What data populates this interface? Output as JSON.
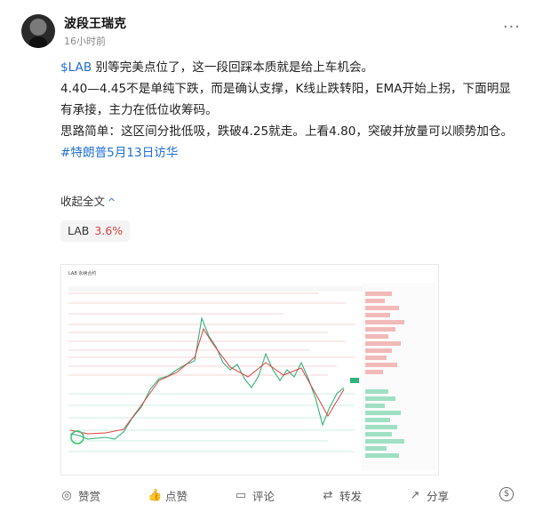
{
  "post": {
    "author": "波段王瑞克",
    "time": "16小时前",
    "more": "···",
    "line1_ticker": "$LAB",
    "line1_rest": " 别等完美点位了，这一段回踩本质就是给上车机会。",
    "line2": "4.40—4.45不是单纯下跌，而是确认支撑，K线止跌转阳，EMA开始上拐，下面明显有承接，主力在低位收筹码。",
    "line3": "思路简单：这区间分批低吸，跌破4.25就走。上看4.80，突破并放量可以顺势加仓。",
    "hashtag": "#特朗普5月13日访华",
    "collapse": "收起全文",
    "ticker_symbol": "LAB",
    "ticker_change": "3.6%"
  },
  "chart_image": {
    "title": "LAB 永续合约 K线图",
    "description_colors": {
      "up": "#2db57a",
      "down": "#e0403f",
      "grid": "#f0c8c8"
    }
  },
  "actions": {
    "reward": "赞赏",
    "like": "点赞",
    "comment": "评论",
    "repost": "转发",
    "share": "分享"
  },
  "colors": {
    "link": "#1f6fd6",
    "up": "#2db57a",
    "down": "#e0403f"
  }
}
